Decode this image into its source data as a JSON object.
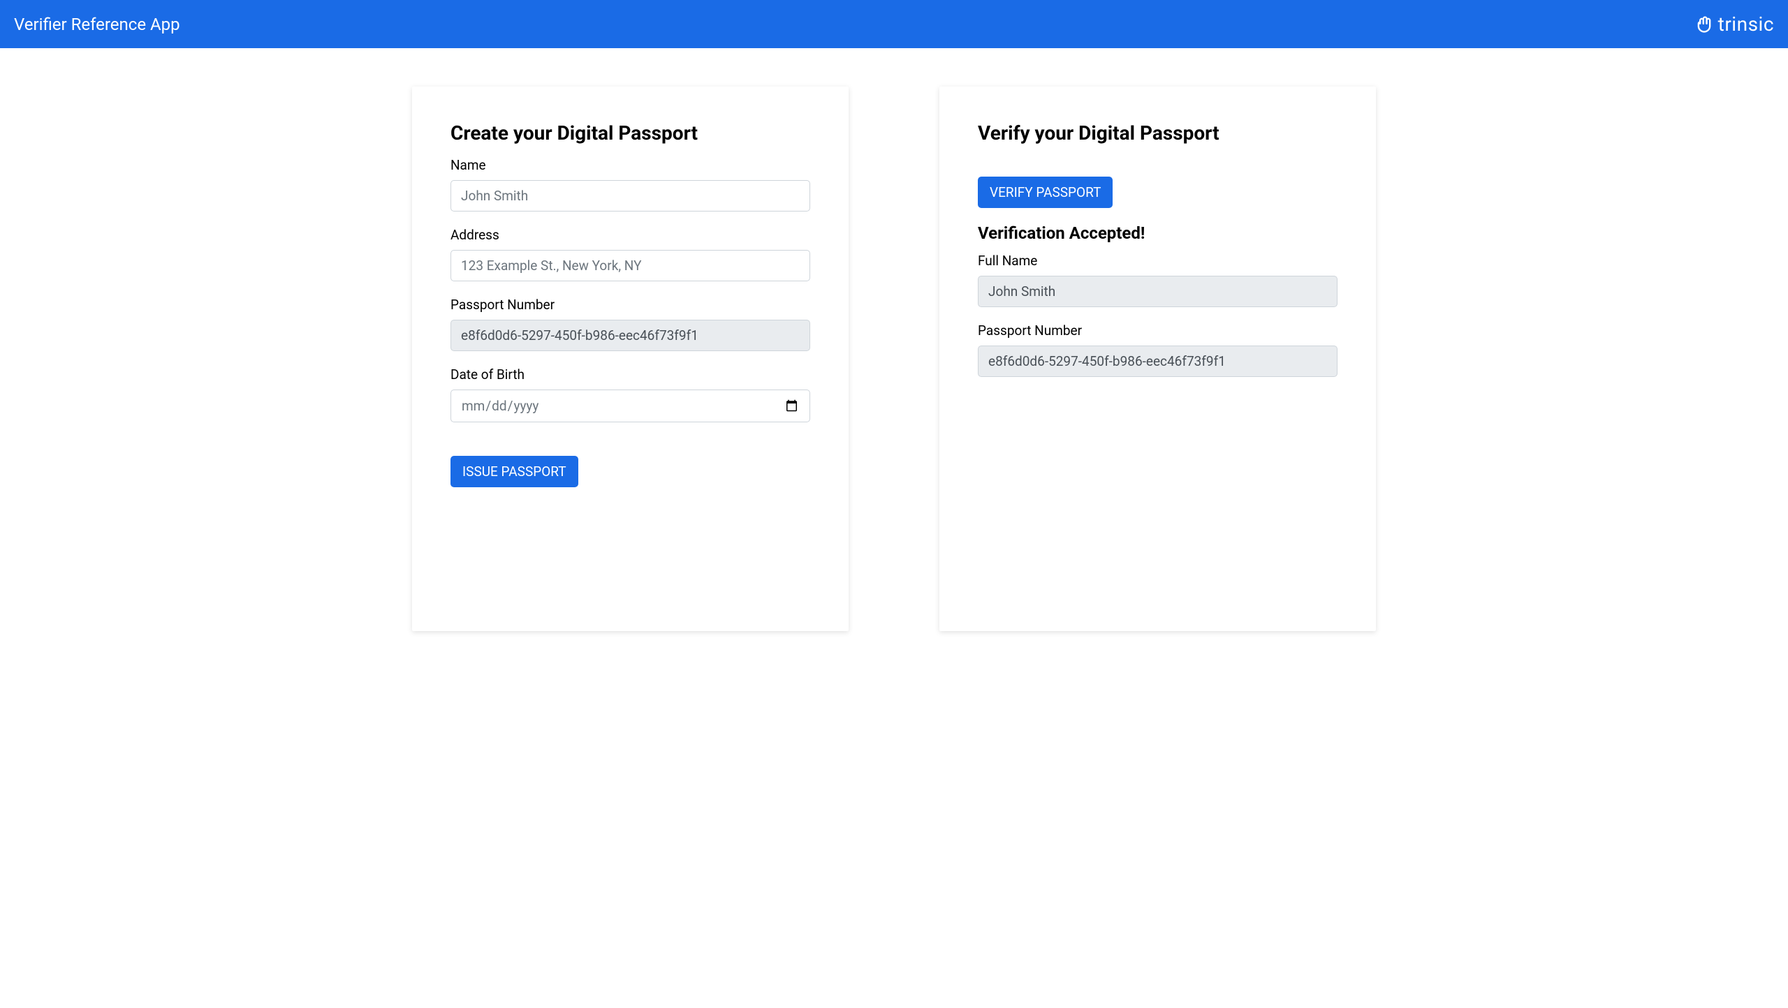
{
  "header": {
    "title": "Verifier Reference App",
    "brand": "trinsic"
  },
  "create": {
    "title": "Create your Digital Passport",
    "name_label": "Name",
    "name_placeholder": "John Smith",
    "address_label": "Address",
    "address_placeholder": "123 Example St., New York, NY",
    "passport_number_label": "Passport Number",
    "passport_number_value": "e8f6d0d6-5297-450f-b986-eec46f73f9f1",
    "dob_label": "Date of Birth",
    "dob_placeholder": "mm/dd/yyyy",
    "issue_button": "ISSUE PASSPORT"
  },
  "verify": {
    "title": "Verify your Digital Passport",
    "verify_button": "VERIFY PASSPORT",
    "status_title": "Verification Accepted!",
    "full_name_label": "Full Name",
    "full_name_value": "John Smith",
    "passport_number_label": "Passport Number",
    "passport_number_value": "e8f6d0d6-5297-450f-b986-eec46f73f9f1"
  }
}
